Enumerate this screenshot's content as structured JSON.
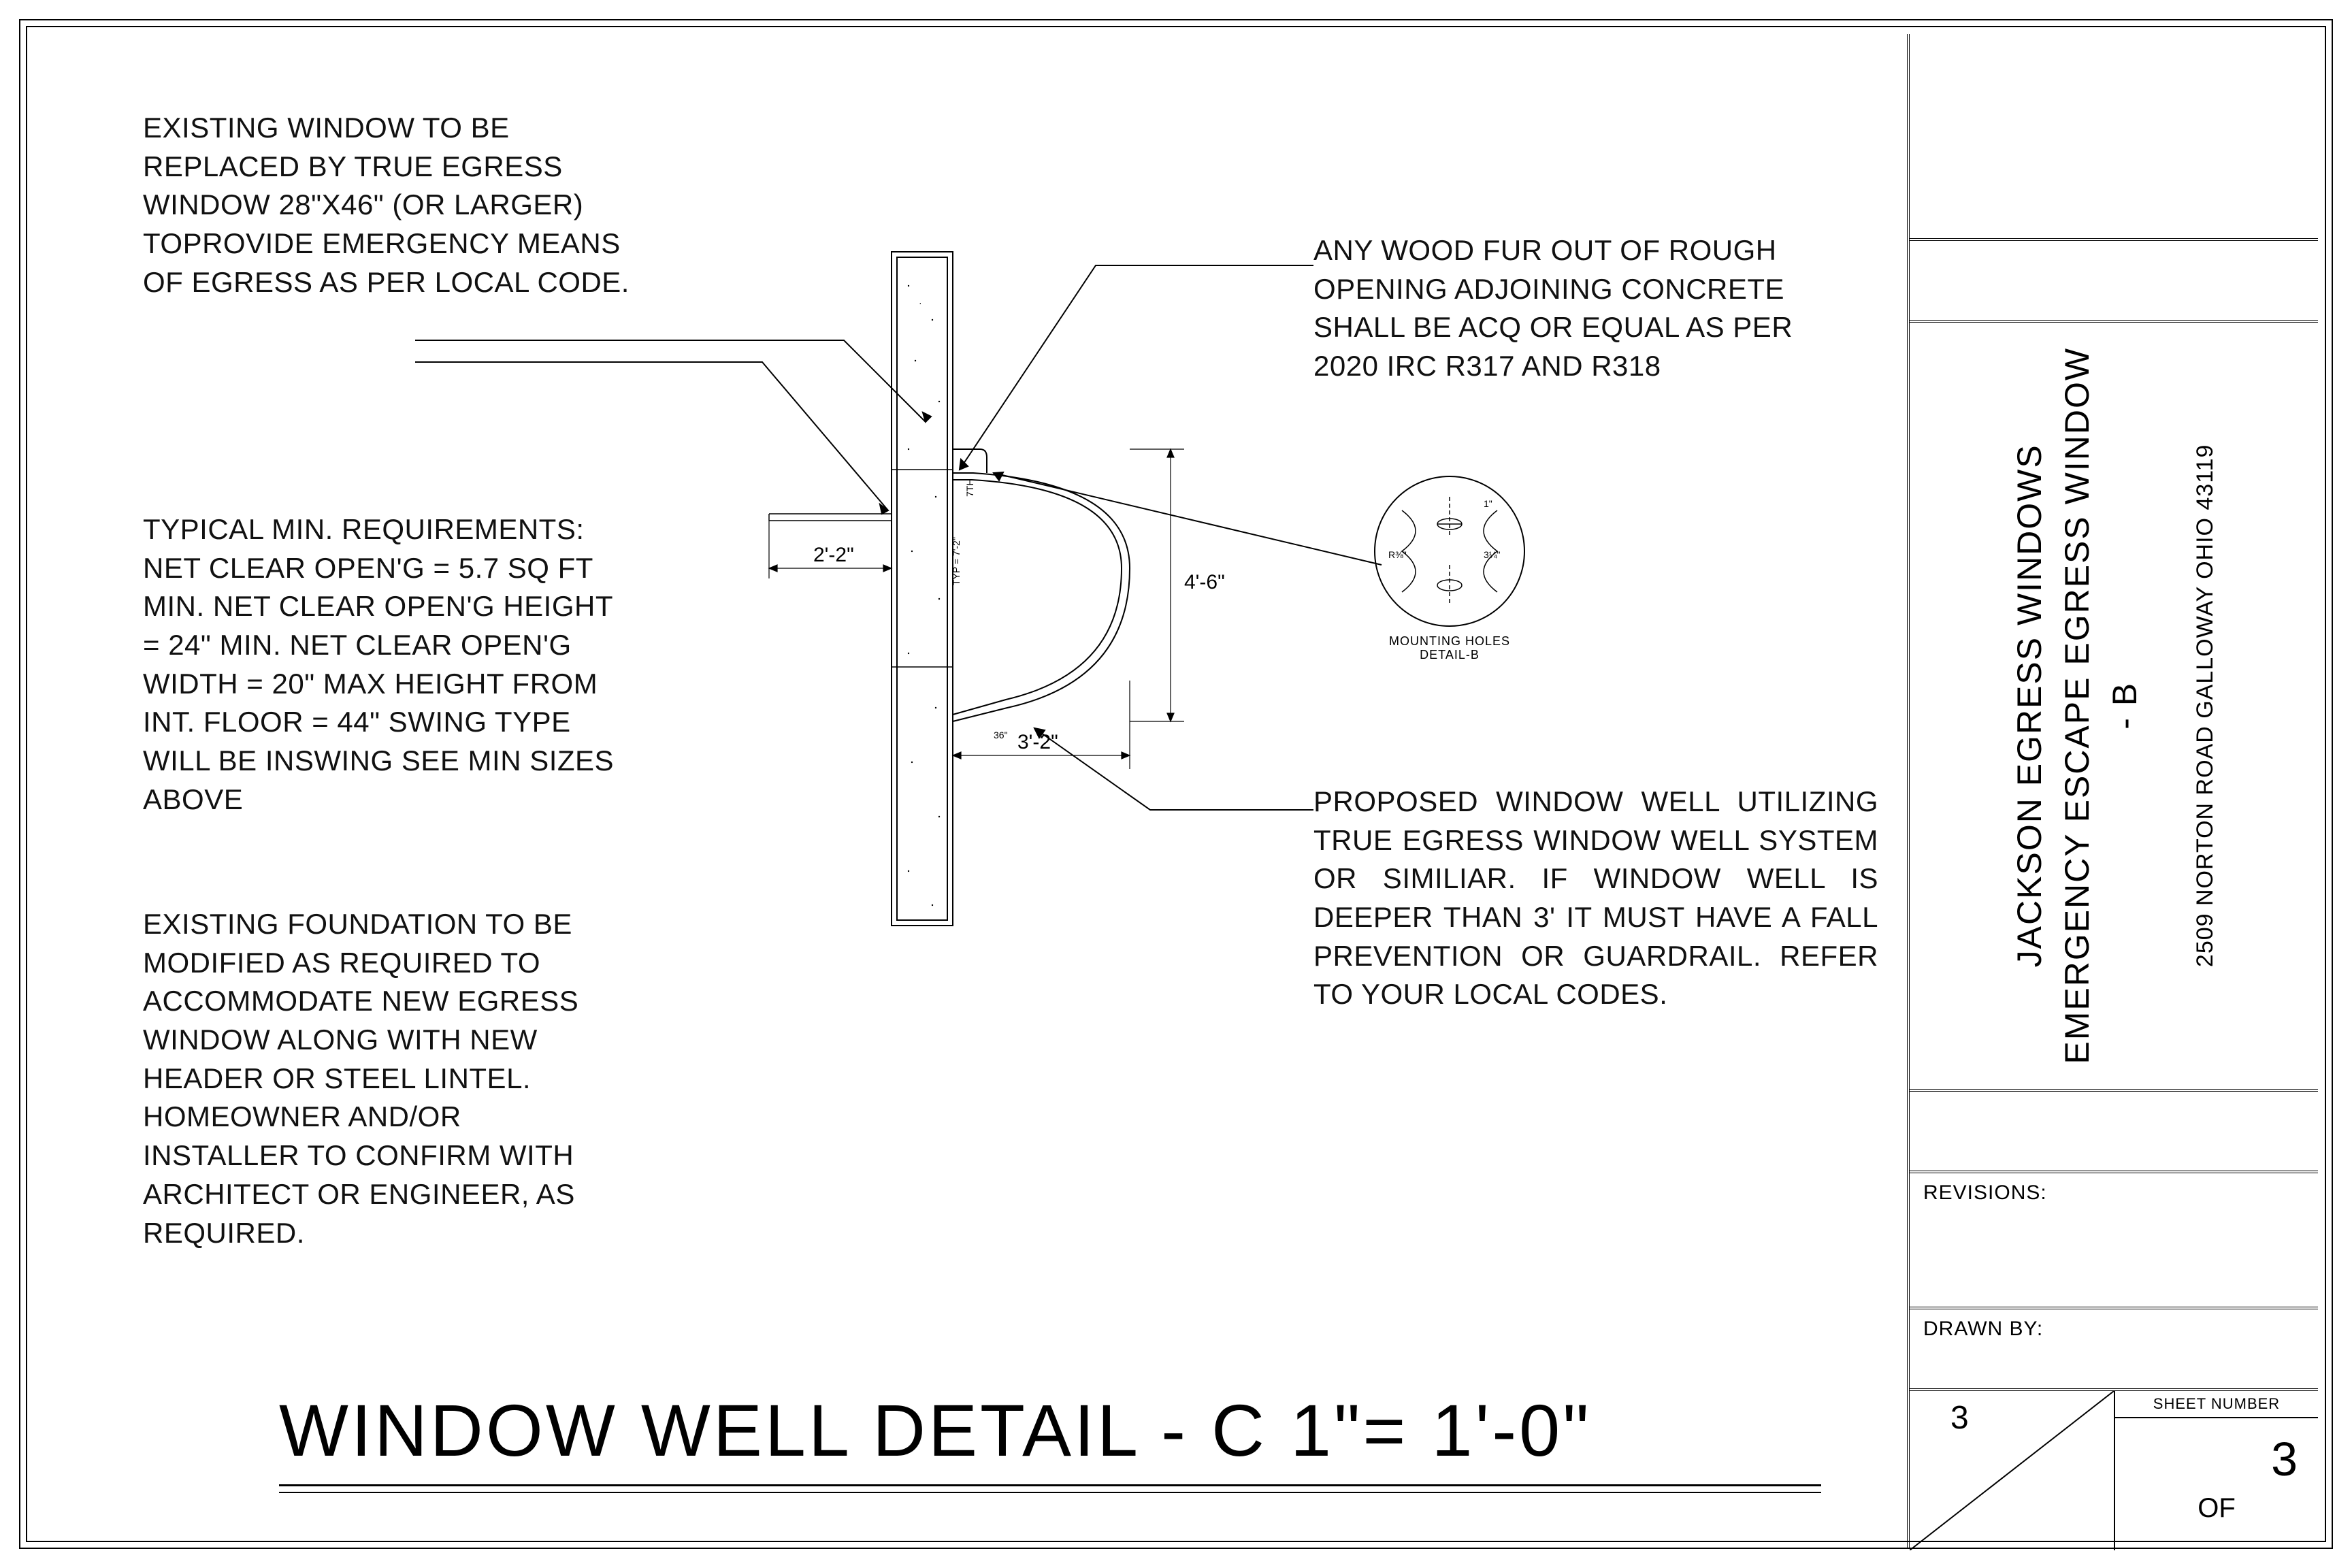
{
  "notes": {
    "n1": "EXISTING WINDOW TO BE REPLACED BY TRUE EGRESS WINDOW 28\"X46\" (OR LARGER) TOPROVIDE EMERGENCY MEANS OF EGRESS AS PER LOCAL CODE.",
    "n2": "TYPICAL MIN. REQUIREMENTS: NET CLEAR OPEN'G = 5.7 SQ FT MIN. NET CLEAR OPEN'G HEIGHT = 24\" MIN. NET CLEAR OPEN'G WIDTH = 20\" MAX HEIGHT FROM INT. FLOOR = 44\" SWING TYPE WILL BE INSWING SEE MIN SIZES ABOVE",
    "n3": "EXISTING FOUNDATION TO BE MODIFIED AS REQUIRED TO ACCOMMODATE NEW EGRESS WINDOW ALONG WITH NEW HEADER OR STEEL LINTEL. HOMEOWNER AND/OR INSTALLER TO CONFIRM WITH ARCHITECT OR ENGINEER, AS REQUIRED.",
    "n4": "ANY WOOD FUR OUT OF ROUGH OPENING ADJOINING CONCRETE SHALL BE ACQ OR EQUAL AS PER 2020 IRC R317 AND R318",
    "n5": "PROPOSED WINDOW WELL UTILIZING TRUE EGRESS WINDOW WELL SYSTEM OR SIMILIAR. IF WINDOW WELL IS DEEPER THAN 3' IT MUST HAVE A FALL PREVENTION OR GUARDRAIL. REFER TO YOUR LOCAL CODES."
  },
  "title": "WINDOW WELL DETAIL - C 1\"= 1'-0\"",
  "dims": {
    "d1": "2'-2\"",
    "d2": "4'-6\"",
    "d3": "3'-2\""
  },
  "detail_caption_l1": "MOUNTING HOLES",
  "detail_caption_l2": "DETAIL-B",
  "titleblock": {
    "company": "JACKSON EGRESS WINDOWS",
    "project_l1": "EMERGENCY ESCAPE EGRESS WINDOW",
    "project_l2": "- B",
    "address": "2509 NORTON ROAD GALLOWAY OHIO 43119",
    "revisions_label": "REVISIONS:",
    "drawn_label": "DRAWN BY:",
    "sheet_label": "SHEET NUMBER",
    "sheet_num": "3",
    "sheet_of_label": "OF",
    "sheet_total": "3"
  }
}
